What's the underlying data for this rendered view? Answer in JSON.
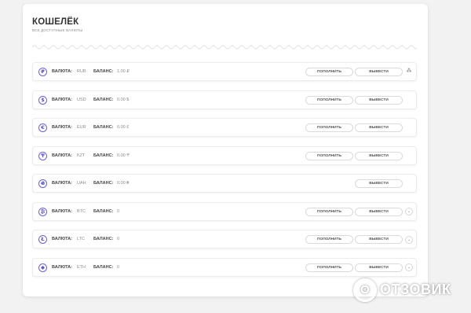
{
  "wallet": {
    "title": "КОШЕЛЁК",
    "subtitle": "все доступные валюты",
    "currency_label": "ВАЛЮТА:",
    "balance_label": "БАЛАНС:",
    "deposit_label": "ПОПОЛНИТЬ",
    "withdraw_label": "ВЫВЕСТИ",
    "rows": [
      {
        "code": "RUB",
        "balance": "1.00 ₽",
        "icon": "ruble-icon",
        "glyph": "₽",
        "deposit": true,
        "extra": "share-icon",
        "extra_glyph": "⁂"
      },
      {
        "code": "USD",
        "balance": "0.00 $",
        "icon": "dollar-icon",
        "glyph": "$",
        "deposit": true,
        "extra": "",
        "extra_glyph": ""
      },
      {
        "code": "EUR",
        "balance": "0.00 €",
        "icon": "euro-icon",
        "glyph": "€",
        "deposit": true,
        "extra": "",
        "extra_glyph": ""
      },
      {
        "code": "KZT",
        "balance": "0.00 ₸",
        "icon": "tenge-icon",
        "glyph": "₸",
        "deposit": true,
        "extra": "",
        "extra_glyph": ""
      },
      {
        "code": "UAH",
        "balance": "0.00 ₴",
        "icon": "hryvnia-icon",
        "glyph": "₴",
        "deposit": false,
        "extra": "",
        "extra_glyph": ""
      },
      {
        "code": "BTC",
        "balance": "0",
        "icon": "bitcoin-icon",
        "glyph": "₿",
        "deposit": true,
        "extra": "chevron-down-icon",
        "extra_glyph": "⌄"
      },
      {
        "code": "LTC",
        "balance": "0",
        "icon": "litecoin-icon",
        "glyph": "Ł",
        "deposit": true,
        "extra": "chevron-down-icon",
        "extra_glyph": "⌄"
      },
      {
        "code": "ETH",
        "balance": "0",
        "icon": "ethereum-icon",
        "glyph": "◆",
        "deposit": true,
        "extra": "chevron-down-icon",
        "extra_glyph": "⌄"
      }
    ]
  },
  "watermark": {
    "logo_glyph": "O",
    "text": "ОТЗОВИК"
  },
  "colors": {
    "accent": "#6a63d6",
    "background": "#f2f2f2",
    "card": "#ffffff"
  }
}
